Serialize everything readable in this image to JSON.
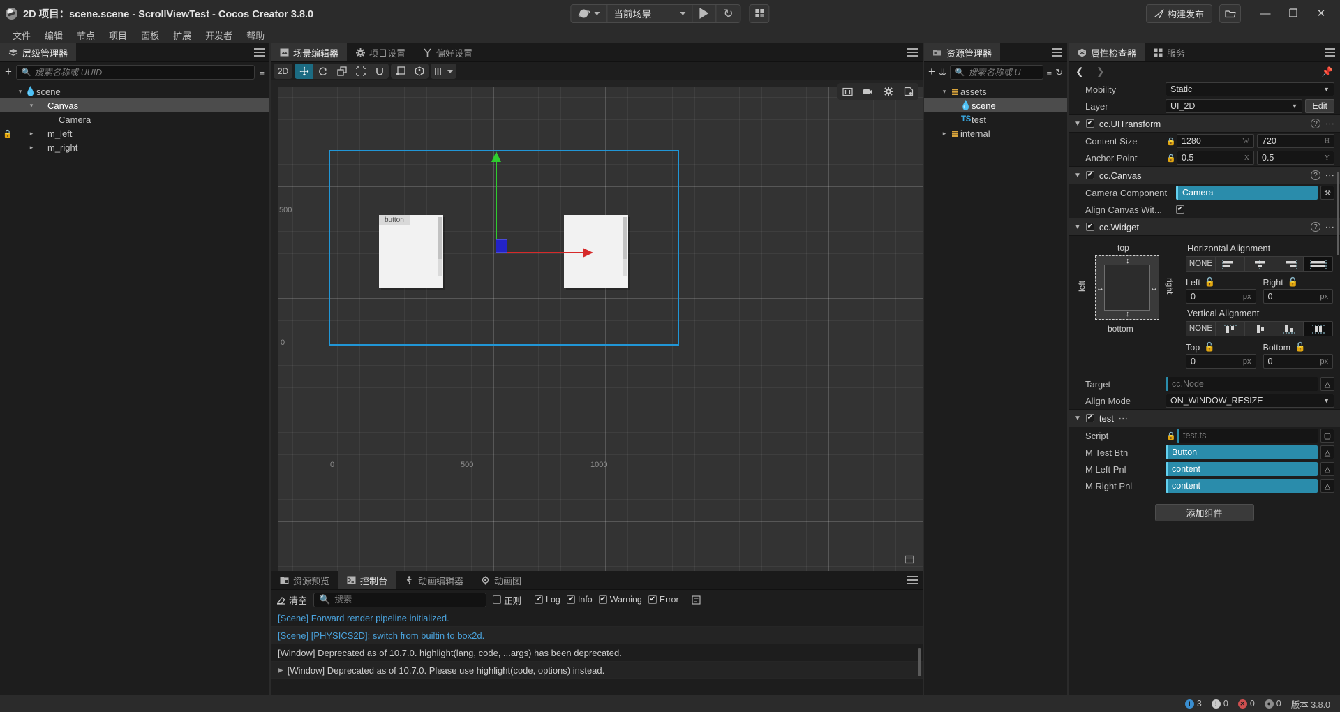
{
  "titlebar": {
    "title": "2D 项目：scene.scene - ScrollViewTest - Cocos Creator 3.8.0",
    "scene_select": "当前场景",
    "build_label": "构建发布",
    "minimize": "—",
    "maximize": "❐",
    "close": "✕"
  },
  "menubar": {
    "items": [
      "文件",
      "编辑",
      "节点",
      "项目",
      "面板",
      "扩展",
      "开发者",
      "帮助"
    ]
  },
  "hierarchy": {
    "tab": "层级管理器",
    "search_placeholder": "搜索名称或 UUID",
    "nodes": [
      {
        "label": "scene",
        "indent": 0,
        "arrow": "down",
        "icon": "flame",
        "selected": false,
        "locked": false
      },
      {
        "label": "Canvas",
        "indent": 1,
        "arrow": "down",
        "icon": "none",
        "selected": true,
        "locked": false
      },
      {
        "label": "Camera",
        "indent": 2,
        "arrow": "none",
        "icon": "none",
        "selected": false,
        "locked": false
      },
      {
        "label": "m_left",
        "indent": 1,
        "arrow": "right",
        "icon": "none",
        "selected": false,
        "locked": true
      },
      {
        "label": "m_right",
        "indent": 1,
        "arrow": "right",
        "icon": "none",
        "selected": false,
        "locked": false
      }
    ]
  },
  "center": {
    "tabs": [
      {
        "label": "场景编辑器",
        "icon": "scene-icon",
        "active": true
      },
      {
        "label": "项目设置",
        "icon": "gear-icon",
        "active": false
      },
      {
        "label": "偏好设置",
        "icon": "wrench-icon",
        "active": false
      }
    ],
    "toolbar": {
      "mode_2d": "2D",
      "tools": [
        "move-tool",
        "rotate-tool",
        "scale-tool",
        "rect-tool",
        "magnet-tool"
      ],
      "extra": [
        "node-tool",
        "cube-tool"
      ],
      "gizmo_menu": "gizmo-visibility"
    },
    "scene": {
      "ruler_labels": [
        "500",
        "0",
        "0",
        "500",
        "1000"
      ],
      "node_label": "button",
      "canvas_color": "#2196d6",
      "axis_y_color": "#2ecc2e",
      "axis_x_color": "#d62a2a",
      "axis_z_color": "#2323c8"
    }
  },
  "console": {
    "tabs": [
      {
        "label": "资源预览",
        "icon": "preview-icon",
        "active": false
      },
      {
        "label": "控制台",
        "icon": "terminal-icon",
        "active": true
      },
      {
        "label": "动画编辑器",
        "icon": "anim-icon",
        "active": false
      },
      {
        "label": "动画图",
        "icon": "graph-icon",
        "active": false
      }
    ],
    "clear_label": "清空",
    "search_placeholder": "搜索",
    "filters": [
      {
        "label": "正则",
        "checked": false
      },
      {
        "label": "Log",
        "checked": true
      },
      {
        "label": "Info",
        "checked": true
      },
      {
        "label": "Warning",
        "checked": true
      },
      {
        "label": "Error",
        "checked": true
      }
    ],
    "logs": [
      {
        "text": "[Scene] Forward render pipeline initialized.",
        "type": "info",
        "expandable": false
      },
      {
        "text": "[Scene] [PHYSICS2D]: switch from builtin to box2d.",
        "type": "info",
        "expandable": false
      },
      {
        "text": "[Window] Deprecated as of 10.7.0. highlight(lang, code, ...args) has been deprecated.",
        "type": "warn",
        "expandable": false
      },
      {
        "text": "[Window] Deprecated as of 10.7.0. Please use highlight(code, options) instead.",
        "type": "warn",
        "expandable": true
      }
    ]
  },
  "assets": {
    "tab": "资源管理器",
    "search_placeholder": "搜索名称或 U",
    "nodes": [
      {
        "label": "assets",
        "indent": 0,
        "arrow": "down",
        "icon": "folder",
        "selected": false
      },
      {
        "label": "scene",
        "indent": 1,
        "arrow": "none",
        "icon": "flame",
        "selected": true
      },
      {
        "label": "test",
        "indent": 1,
        "arrow": "none",
        "icon": "ts",
        "selected": false
      },
      {
        "label": "internal",
        "indent": 0,
        "arrow": "right",
        "icon": "folder",
        "selected": false
      }
    ]
  },
  "inspector": {
    "tabs": [
      {
        "label": "属性检查器",
        "icon": "inspector-icon",
        "active": true
      },
      {
        "label": "服务",
        "icon": "services-icon",
        "active": false
      }
    ],
    "node_props": [
      {
        "label": "Mobility",
        "value": "Static",
        "type": "dropdown"
      },
      {
        "label": "Layer",
        "value": "UI_2D",
        "type": "dropdown-edit",
        "button": "Edit"
      }
    ],
    "components": [
      {
        "name": "cc.UITransform",
        "enabled": true,
        "rows": [
          {
            "label": "Content Size",
            "locked": true,
            "fields": [
              {
                "value": "1280",
                "suffix": "W"
              },
              {
                "value": "720",
                "suffix": "H"
              }
            ]
          },
          {
            "label": "Anchor Point",
            "locked": true,
            "fields": [
              {
                "value": "0.5",
                "suffix": "X"
              },
              {
                "value": "0.5",
                "suffix": "Y"
              }
            ]
          }
        ]
      },
      {
        "name": "cc.Canvas",
        "enabled": true,
        "rows": [
          {
            "label": "Camera Component",
            "type": "object",
            "value": "Camera"
          },
          {
            "label": "Align Canvas Wit...",
            "type": "checkbox",
            "checked": true
          }
        ]
      },
      {
        "name": "cc.Widget",
        "enabled": true,
        "widget": {
          "diagram": {
            "top": "top",
            "bottom": "bottom",
            "left": "left",
            "right": "right"
          },
          "horizontal_title": "Horizontal Alignment",
          "horizontal_options": [
            "NONE",
            "left-align",
            "center-align",
            "right-align",
            "stretch-h"
          ],
          "horizontal_selected": 4,
          "left_label": "Left",
          "left_value": "0",
          "left_unit": "px",
          "right_label": "Right",
          "right_value": "0",
          "right_unit": "px",
          "vertical_title": "Vertical Alignment",
          "vertical_options": [
            "NONE",
            "top-align",
            "middle-align",
            "bottom-align",
            "stretch-v"
          ],
          "vertical_selected": 4,
          "top_label": "Top",
          "top_value": "0",
          "top_unit": "px",
          "bottom_label": "Bottom",
          "bottom_value": "0",
          "bottom_unit": "px",
          "target_label": "Target",
          "target_value": "cc.Node",
          "align_mode_label": "Align Mode",
          "align_mode_value": "ON_WINDOW_RESIZE"
        }
      },
      {
        "name": "test",
        "enabled": true,
        "rows": [
          {
            "label": "Script",
            "type": "script",
            "value": "test.ts",
            "locked": true
          },
          {
            "label": "M Test Btn",
            "type": "object",
            "value": "Button"
          },
          {
            "label": "M Left Pnl",
            "type": "object",
            "value": "content"
          },
          {
            "label": "M Right Pnl",
            "type": "object",
            "value": "content"
          }
        ]
      }
    ],
    "add_component": "添加组件"
  },
  "statusbar": {
    "info_count": "3",
    "warn_count": "0",
    "error_count": "0",
    "msg_count": "0",
    "version": "版本 3.8.0"
  }
}
